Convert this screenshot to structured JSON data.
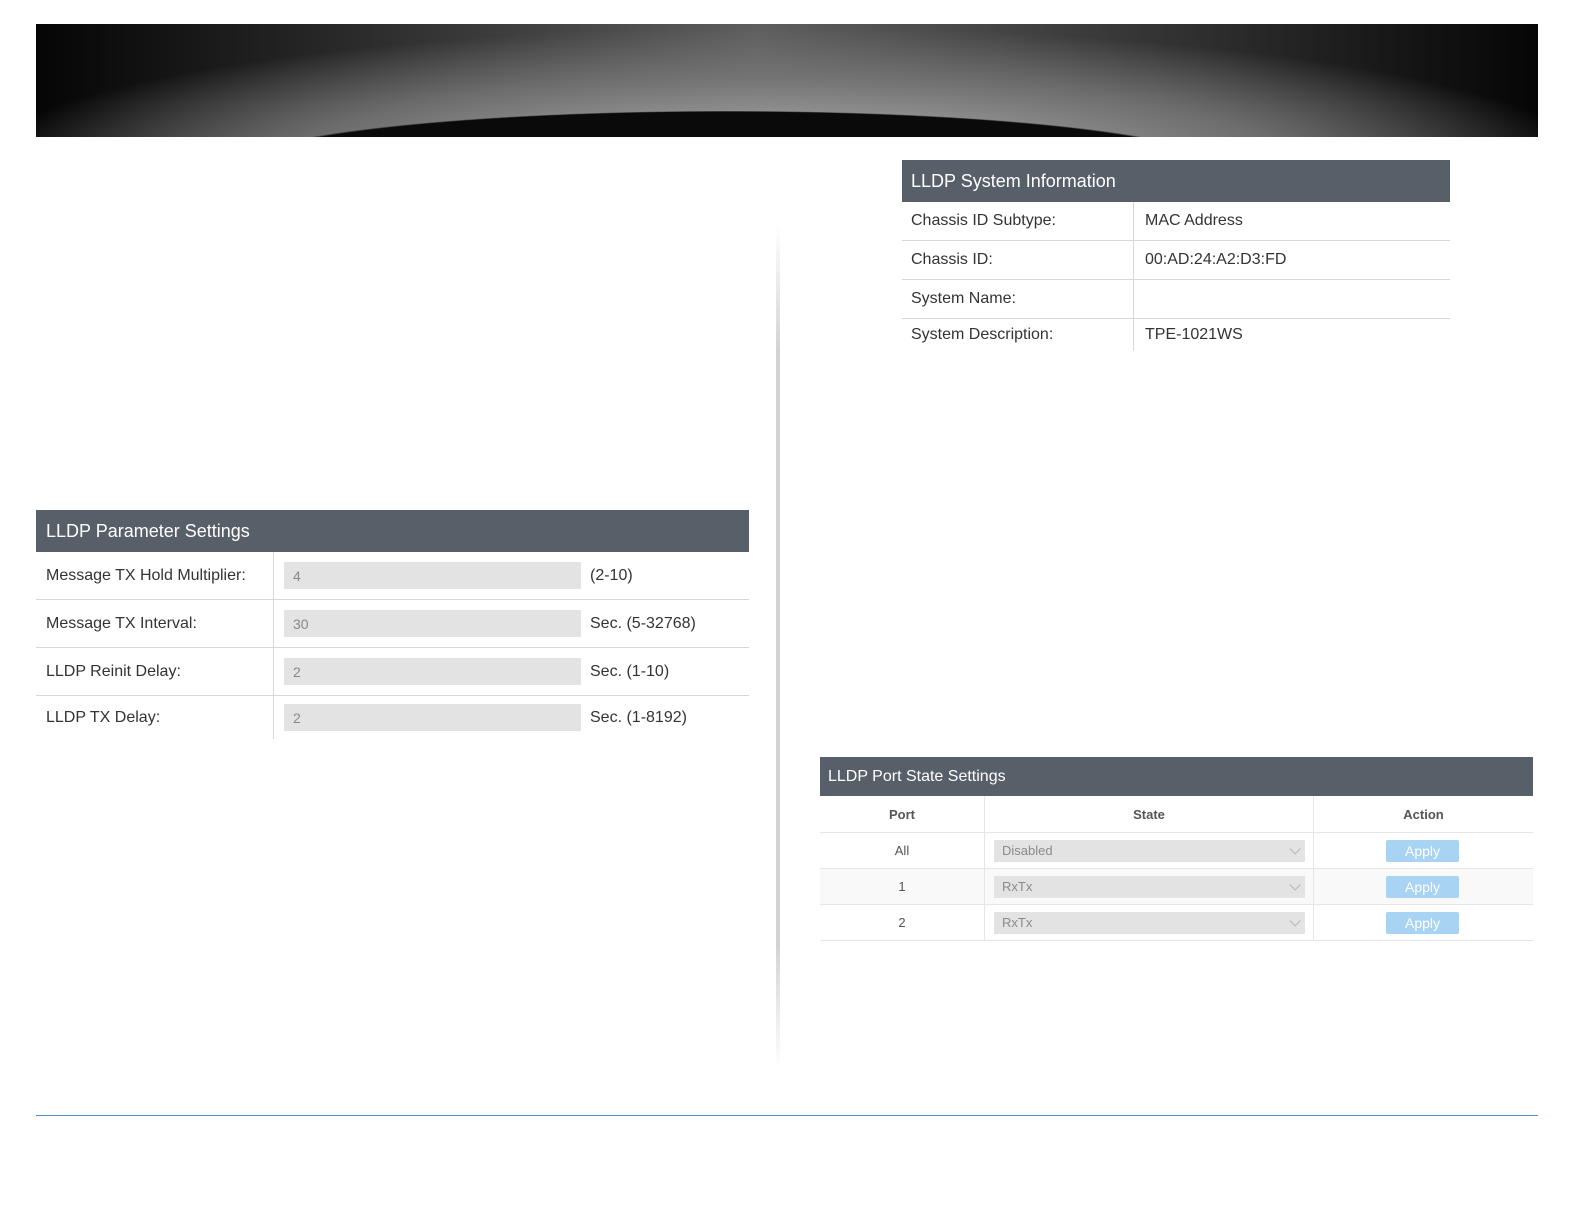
{
  "system_info": {
    "title": "LLDP System Information",
    "rows": [
      {
        "label": "Chassis ID Subtype:",
        "value": "MAC Address"
      },
      {
        "label": "Chassis ID:",
        "value": "00:AD:24:A2:D3:FD"
      },
      {
        "label": "System Name:",
        "value": ""
      },
      {
        "label": "System Description:",
        "value": "TPE-1021WS"
      }
    ]
  },
  "parameters": {
    "title": "LLDP Parameter Settings",
    "rows": [
      {
        "label": "Message TX Hold Multiplier:",
        "value": "4",
        "unit": "(2-10)"
      },
      {
        "label": "Message TX Interval:",
        "value": "30",
        "unit": "Sec. (5-32768)"
      },
      {
        "label": "LLDP Reinit Delay:",
        "value": "2",
        "unit": "Sec. (1-10)"
      },
      {
        "label": "LLDP TX Delay:",
        "value": "2",
        "unit": "Sec. (1-8192)"
      }
    ]
  },
  "port_state": {
    "title": "LLDP Port State Settings",
    "columns": {
      "port": "Port",
      "state": "State",
      "action": "Action"
    },
    "rows": [
      {
        "port": "All",
        "state": "Disabled",
        "action": "Apply"
      },
      {
        "port": "1",
        "state": "RxTx",
        "action": "Apply"
      },
      {
        "port": "2",
        "state": "RxTx",
        "action": "Apply"
      }
    ]
  },
  "colors": {
    "panel_header": "#575f69",
    "apply_button": "#a9d3f3",
    "footer_line": "#5b8bc6"
  },
  "icons": {
    "select_arrow": "chevron-down-icon"
  }
}
